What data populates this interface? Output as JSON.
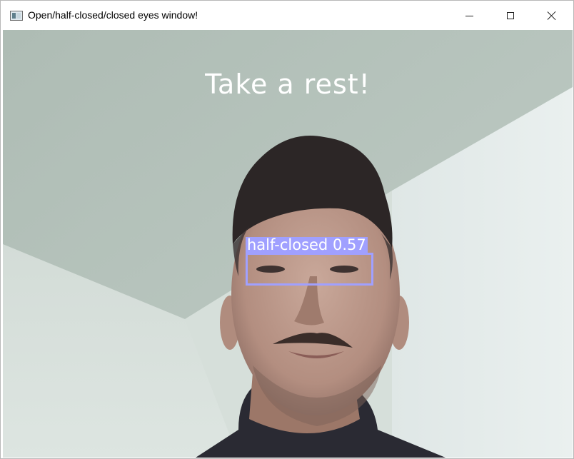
{
  "window": {
    "title": "Open/half-closed/closed eyes window!",
    "icon": "app-window-icon",
    "controls": [
      "minimize",
      "maximize",
      "close"
    ]
  },
  "feed": {
    "message": "Take a rest!",
    "detection": {
      "class_label": "half-closed",
      "confidence": "0.57",
      "box_color": "#a0a0ff"
    }
  }
}
